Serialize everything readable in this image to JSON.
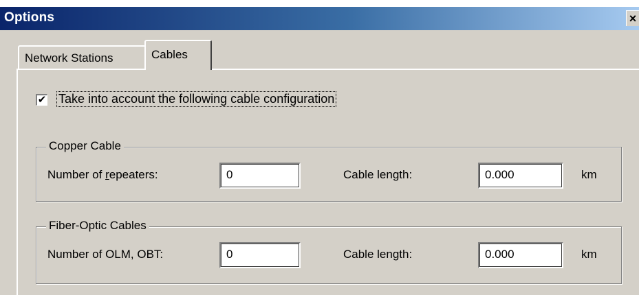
{
  "window": {
    "title": "Options",
    "close_glyph": "×"
  },
  "tabs": [
    {
      "label": "Network Stations",
      "active": false
    },
    {
      "label": "Cables",
      "active": true
    }
  ],
  "checkbox": {
    "checked": true,
    "mark": "✔",
    "label": "Take into account the following cable configuration"
  },
  "copper": {
    "legend": "Copper Cable",
    "repeaters_label_pre": "Number of ",
    "repeaters_label_u": "r",
    "repeaters_label_post": "epeaters:",
    "repeaters_value": "0",
    "length_label": "Cable length:",
    "length_value": "0.000",
    "unit": "km"
  },
  "fiber": {
    "legend": "Fiber-Optic Cables",
    "olm_label": "Number of OLM, OBT:",
    "olm_value": "0",
    "length_label": "Cable length:",
    "length_value": "0.000",
    "unit": "km"
  }
}
